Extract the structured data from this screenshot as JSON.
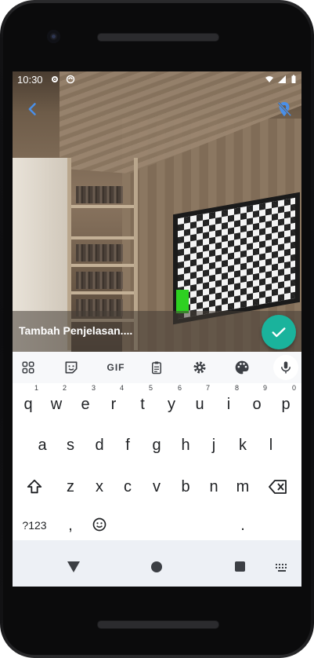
{
  "status_bar": {
    "time": "10:30"
  },
  "photo": {
    "caption": "Tambah Penjelasan...."
  },
  "keyboard": {
    "toolbar": {
      "gif_label": "GIF"
    },
    "row1": [
      {
        "key": "q",
        "hint": "1"
      },
      {
        "key": "w",
        "hint": "2"
      },
      {
        "key": "e",
        "hint": "3"
      },
      {
        "key": "r",
        "hint": "4"
      },
      {
        "key": "t",
        "hint": "5"
      },
      {
        "key": "y",
        "hint": "6"
      },
      {
        "key": "u",
        "hint": "7"
      },
      {
        "key": "i",
        "hint": "8"
      },
      {
        "key": "o",
        "hint": "9"
      },
      {
        "key": "p",
        "hint": "0"
      }
    ],
    "row2": [
      "a",
      "s",
      "d",
      "f",
      "g",
      "h",
      "j",
      "k",
      "l"
    ],
    "row3": [
      "z",
      "x",
      "c",
      "v",
      "b",
      "n",
      "m"
    ],
    "row4": {
      "symbols": "?123",
      "comma": ",",
      "period": "."
    }
  },
  "colors": {
    "accent": "#1a73e8",
    "fab": "#1ab39c",
    "back_icon": "#4a8fe8"
  }
}
